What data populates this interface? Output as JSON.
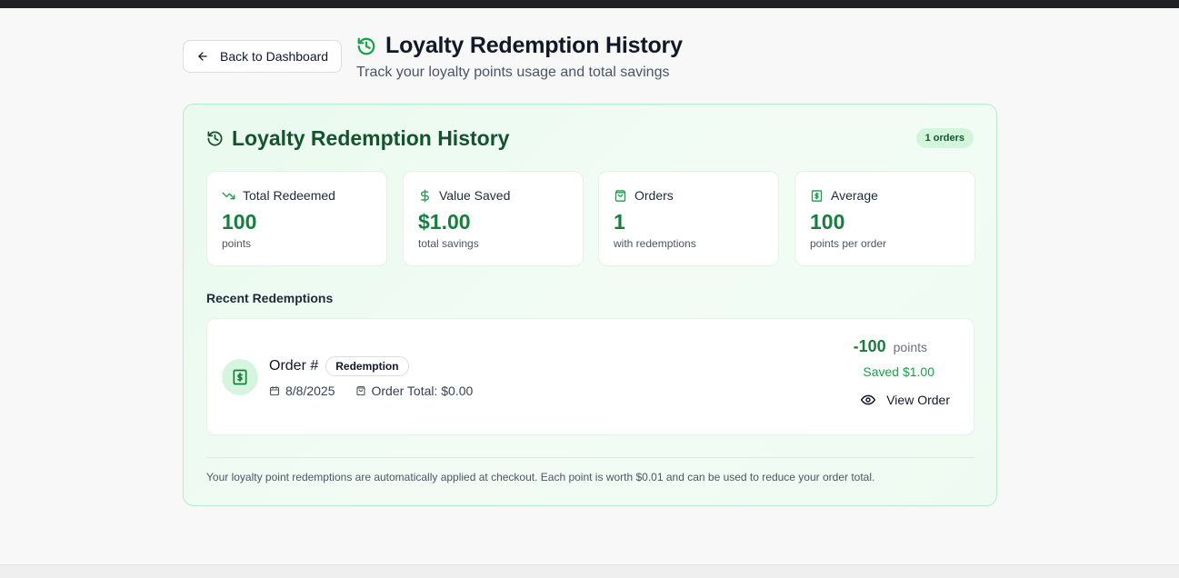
{
  "header": {
    "back_label": "Back to Dashboard",
    "title": "Loyalty Redemption History",
    "subtitle": "Track your loyalty points usage and total savings"
  },
  "card": {
    "title": "Loyalty Redemption History",
    "orders_badge": "1 orders",
    "stats": [
      {
        "icon": "trending-down-icon",
        "label": "Total Redeemed",
        "value": "100",
        "sub": "points"
      },
      {
        "icon": "dollar-icon",
        "label": "Value Saved",
        "value": "$1.00",
        "sub": "total savings"
      },
      {
        "icon": "shopping-bag-icon",
        "label": "Orders",
        "value": "1",
        "sub": "with redemptions"
      },
      {
        "icon": "receipt-icon",
        "label": "Average",
        "value": "100",
        "sub": "points per order"
      }
    ],
    "section_title": "Recent Redemptions",
    "redemptions": [
      {
        "order_label": "Order #",
        "tag": "Redemption",
        "date": "8/8/2025",
        "order_total": "Order Total: $0.00",
        "points": "-100",
        "points_unit": "points",
        "saved": "Saved $1.00",
        "view_label": "View Order"
      }
    ],
    "footnote": "Your loyalty point redemptions are automatically applied at checkout. Each point is worth $0.01 and can be used to reduce your order total."
  },
  "colors": {
    "accent": "#15803d",
    "card_bg": "#effbf2",
    "card_border": "#b7ebc6"
  }
}
